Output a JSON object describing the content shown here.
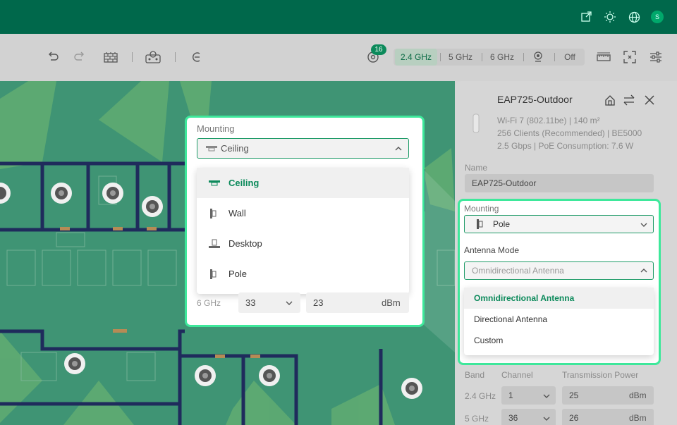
{
  "header": {
    "icons": [
      "external-link-icon",
      "brightness-icon",
      "globe-icon"
    ],
    "avatar_letter": "S"
  },
  "toolbar": {
    "notification_count": "16",
    "bands": [
      "2.4 GHz",
      "5 GHz",
      "6 GHz",
      "Off"
    ]
  },
  "panel": {
    "device_name": "EAP725-Outdoor",
    "meta": [
      "Wi-Fi 7 (802.11be) | 140 m²",
      "256 Clients (Recommended) | BE5000",
      "2.5 Gbps | PoE Consumption: 7.6 W"
    ],
    "name_label": "Name",
    "name_value": "EAP725-Outdoor",
    "table_headers": [
      "Band",
      "Channel",
      "Transmission Power"
    ],
    "rows": [
      {
        "band": "2.4 GHz",
        "channel": "1",
        "power": "25",
        "unit": "dBm"
      },
      {
        "band": "5 GHz",
        "channel": "36",
        "power": "26",
        "unit": "dBm"
      }
    ]
  },
  "callout_left": {
    "label": "Mounting",
    "selected": "Ceiling",
    "options": [
      "Ceiling",
      "Wall",
      "Desktop",
      "Pole"
    ],
    "row": {
      "band": "6 GHz",
      "channel": "33",
      "power": "23",
      "unit": "dBm"
    }
  },
  "callout_right": {
    "mounting_label": "Mounting",
    "mounting_value": "Pole",
    "antenna_label": "Antenna Mode",
    "antenna_value": "Omnidirectional Antenna",
    "options": [
      "Omnidirectional Antenna",
      "Directional Antenna",
      "Custom"
    ]
  },
  "colors": {
    "header": "#00684b",
    "accent": "#0c8a5b",
    "callout_border": "#3ee89b"
  }
}
